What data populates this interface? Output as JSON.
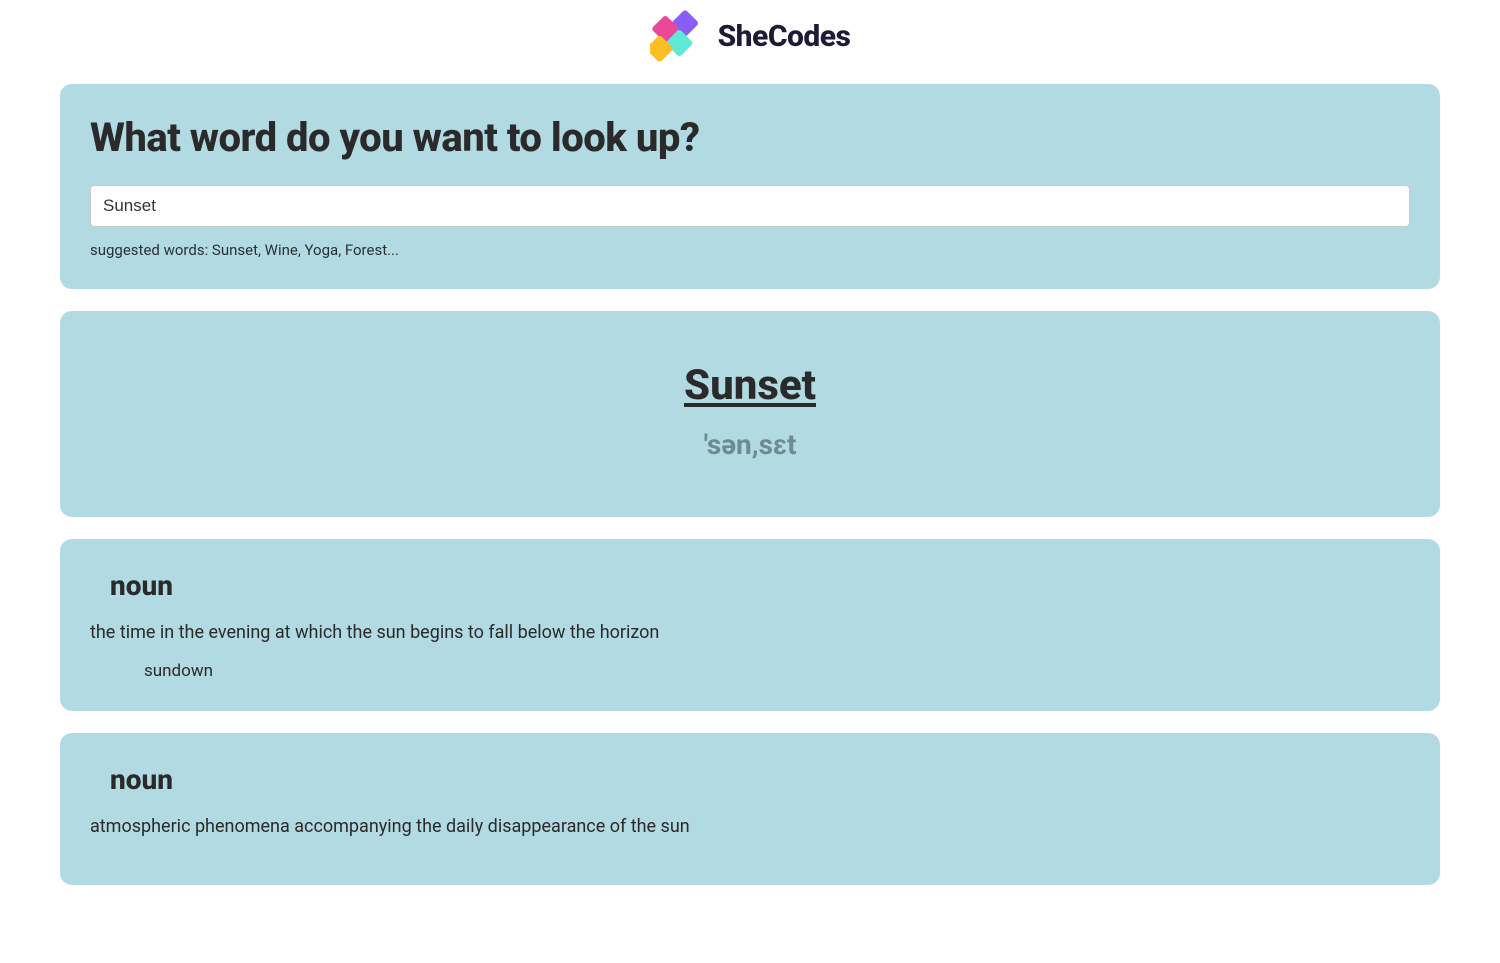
{
  "header": {
    "brand": "SheCodes"
  },
  "search": {
    "heading": "What word do you want to look up?",
    "value": "Sunset",
    "hint": "suggested words: Sunset, Wine, Yoga, Forest..."
  },
  "result": {
    "word": "Sunset",
    "phonetic": "'sən,sɛt"
  },
  "meanings": [
    {
      "partOfSpeech": "noun",
      "definition": "the time in the evening at which the sun begins to fall below the horizon",
      "synonym": "sundown"
    },
    {
      "partOfSpeech": "noun",
      "definition": "atmospheric phenomena accompanying the daily disappearance of the sun"
    }
  ]
}
